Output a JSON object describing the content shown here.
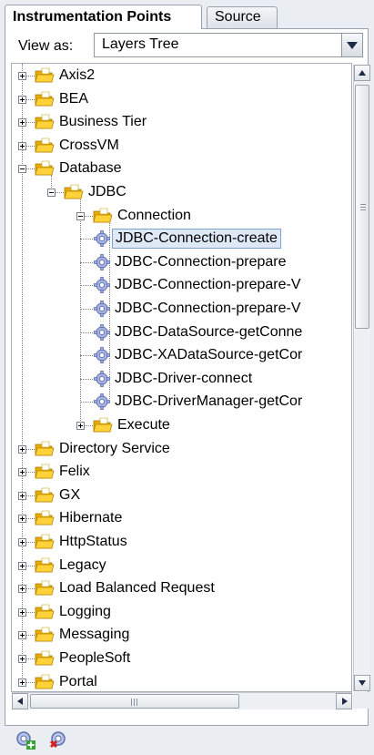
{
  "tabs": [
    {
      "label": "Instrumentation Points"
    },
    {
      "label": "Source"
    }
  ],
  "view_as": {
    "label": "View as:",
    "value": "Layers Tree"
  },
  "tree": {
    "nodes": [
      {
        "label": "Axis2"
      },
      {
        "label": "BEA"
      },
      {
        "label": "Business Tier"
      },
      {
        "label": "CrossVM"
      },
      {
        "label": "Database"
      },
      {
        "label": "JDBC"
      },
      {
        "label": "Connection"
      },
      {
        "label": "JDBC-Connection-create"
      },
      {
        "label": "JDBC-Connection-prepare"
      },
      {
        "label": "JDBC-Connection-prepare-V"
      },
      {
        "label": "JDBC-Connection-prepare-V"
      },
      {
        "label": "JDBC-DataSource-getConne"
      },
      {
        "label": "JDBC-XADataSource-getCor"
      },
      {
        "label": "JDBC-Driver-connect"
      },
      {
        "label": "JDBC-DriverManager-getCor"
      },
      {
        "label": "Execute"
      },
      {
        "label": "Directory Service"
      },
      {
        "label": "Felix"
      },
      {
        "label": "GX"
      },
      {
        "label": "Hibernate"
      },
      {
        "label": "HttpStatus"
      },
      {
        "label": "Legacy"
      },
      {
        "label": "Load Balanced Request"
      },
      {
        "label": "Logging"
      },
      {
        "label": "Messaging"
      },
      {
        "label": "PeopleSoft"
      },
      {
        "label": "Portal"
      }
    ],
    "selected": "JDBC-Connection-create"
  },
  "toolbar": {
    "icons": [
      "add-point-icon",
      "remove-point-icon"
    ]
  },
  "colors": {
    "folder": "#f2c400",
    "gear": "#8c9bd0",
    "selection": "#dfe8f6"
  }
}
